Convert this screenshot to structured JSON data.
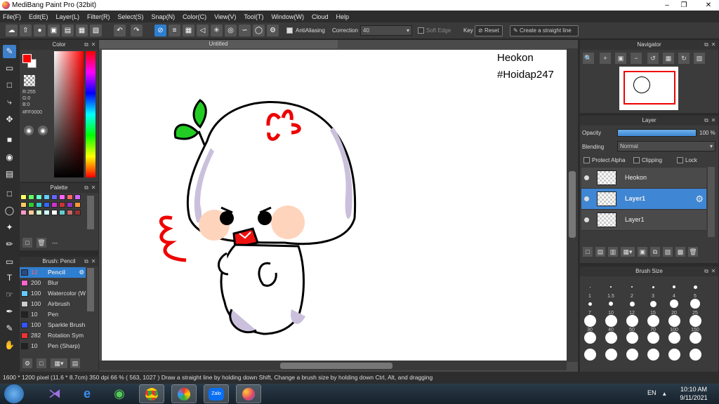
{
  "window": {
    "title": "MediBang Paint Pro (32bit)"
  },
  "menu": [
    "File(F)",
    "Edit(E)",
    "Layer(L)",
    "Filter(R)",
    "Select(S)",
    "Snap(N)",
    "Color(C)",
    "View(V)",
    "Tool(T)",
    "Window(W)",
    "Cloud",
    "Help"
  ],
  "toolbar": {
    "antialiasing": "AntiAliasing",
    "correction_label": "Correction",
    "correction_value": "40",
    "soft_edge": "Soft Edge",
    "key_label": "Key",
    "reset": "Reset",
    "straight_line": "Create a straight line"
  },
  "color_panel": {
    "title": "Color",
    "r": "R:255",
    "g": "G:0",
    "b": "B:0",
    "hex": "#FF0000",
    "primary": "#ff0000"
  },
  "palette_panel": {
    "title": "Palette",
    "dashes": "---",
    "swatches": [
      "#ffff66",
      "#66ff66",
      "#66ffcc",
      "#66ccff",
      "#6666ff",
      "#ff66ff",
      "#ff6666",
      "#cc66ff",
      "#ffcc66",
      "#33cc33",
      "#33cccc",
      "#3366ff",
      "#cc33cc",
      "#cc3333",
      "#9933cc",
      "#ff9933",
      "#ff99cc",
      "#ffcc99",
      "#ccffcc",
      "#ccffff",
      "#ffffff",
      "#66cccc",
      "#cc6666",
      "#993333"
    ]
  },
  "brush_panel": {
    "title": "Brush: Pencil",
    "items": [
      {
        "size": "12",
        "name": "Pencil",
        "color": "#2d4a80"
      },
      {
        "size": "200",
        "name": "Blur",
        "color": "#ff66cc"
      },
      {
        "size": "100",
        "name": "Watercolor (W",
        "color": "#66ccff"
      },
      {
        "size": "100",
        "name": "Airbrush",
        "color": "#cccccc"
      },
      {
        "size": "10",
        "name": "Pen",
        "color": "#222222"
      },
      {
        "size": "100",
        "name": "Sparkle Brush",
        "color": "#3355ff"
      },
      {
        "size": "282",
        "name": "Rotation Sym",
        "color": "#ee3333"
      },
      {
        "size": "10",
        "name": "Pen (Sharp)",
        "color": "#222222"
      }
    ]
  },
  "document": {
    "tab": "Untitled",
    "watermark_1": "Heokon",
    "watermark_2": "#Hoidap247"
  },
  "navigator": {
    "title": "Navigator"
  },
  "layer_panel": {
    "title": "Layer",
    "opacity_label": "Opacity",
    "opacity_value": "100 %",
    "blending_label": "Blending",
    "blending_value": "Normal",
    "protect_alpha": "Protect Alpha",
    "clipping": "Clipping",
    "lock": "Lock",
    "layers": [
      {
        "name": "Heokon"
      },
      {
        "name": "Layer1"
      },
      {
        "name": "Layer1"
      }
    ]
  },
  "brush_size_panel": {
    "title": "Brush Size",
    "labels": [
      "1",
      "1.5",
      "2",
      "3",
      "4",
      "5",
      "7",
      "10",
      "12",
      "15",
      "20",
      "25",
      "30",
      "40",
      "50",
      "70",
      "100",
      "150"
    ]
  },
  "status": {
    "text": "1600 * 1200 pixel   (11.6 * 8.7cm)   350 dpi   66 %   ( 563, 1027 )   Draw a straight line by holding down Shift, Change a brush size by holding down Ctrl, Alt, and dragging"
  },
  "taskbar": {
    "lang": "EN",
    "time": "10:10 AM",
    "date": "9/11/2021",
    "zalo": "Zalo"
  }
}
